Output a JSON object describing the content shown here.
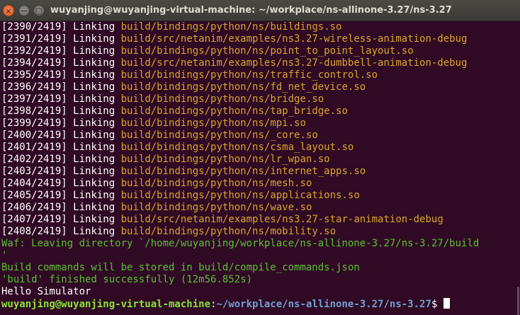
{
  "window": {
    "title": "wuyanjing@wuyanjing-virtual-machine: ~/workplace/ns-allinone-3.27/ns-3.27",
    "close_icon": "×",
    "minimize_icon": "−",
    "maximize_icon": "□"
  },
  "link_lines": [
    {
      "progress": "[2390/2419]",
      "verb": "Linking",
      "path": "build/bindings/python/ns/buildings.so"
    },
    {
      "progress": "[2391/2419]",
      "verb": "Linking",
      "path": "build/src/netanim/examples/ns3.27-wireless-animation-debug"
    },
    {
      "progress": "[2392/2419]",
      "verb": "Linking",
      "path": "build/bindings/python/ns/point_to_point_layout.so"
    },
    {
      "progress": "[2394/2419]",
      "verb": "Linking",
      "path": "build/src/netanim/examples/ns3.27-dumbbell-animation-debug"
    },
    {
      "progress": "[2395/2419]",
      "verb": "Linking",
      "path": "build/bindings/python/ns/traffic_control.so"
    },
    {
      "progress": "[2396/2419]",
      "verb": "Linking",
      "path": "build/bindings/python/ns/fd_net_device.so"
    },
    {
      "progress": "[2397/2419]",
      "verb": "Linking",
      "path": "build/bindings/python/ns/bridge.so"
    },
    {
      "progress": "[2398/2419]",
      "verb": "Linking",
      "path": "build/bindings/python/ns/tap_bridge.so"
    },
    {
      "progress": "[2399/2419]",
      "verb": "Linking",
      "path": "build/bindings/python/ns/mpi.so"
    },
    {
      "progress": "[2400/2419]",
      "verb": "Linking",
      "path": "build/bindings/python/ns/_core.so"
    },
    {
      "progress": "[2401/2419]",
      "verb": "Linking",
      "path": "build/bindings/python/ns/csma_layout.so"
    },
    {
      "progress": "[2402/2419]",
      "verb": "Linking",
      "path": "build/bindings/python/ns/lr_wpan.so"
    },
    {
      "progress": "[2403/2419]",
      "verb": "Linking",
      "path": "build/bindings/python/ns/internet_apps.so"
    },
    {
      "progress": "[2404/2419]",
      "verb": "Linking",
      "path": "build/bindings/python/ns/mesh.so"
    },
    {
      "progress": "[2405/2419]",
      "verb": "Linking",
      "path": "build/bindings/python/ns/applications.so"
    },
    {
      "progress": "[2406/2419]",
      "verb": "Linking",
      "path": "build/bindings/python/ns/wave.so"
    },
    {
      "progress": "[2407/2419]",
      "verb": "Linking",
      "path": "build/src/netanim/examples/ns3.27-star-animation-debug"
    },
    {
      "progress": "[2408/2419]",
      "verb": "Linking",
      "path": "build/bindings/python/ns/mobility.so"
    }
  ],
  "output": {
    "waf_leaving": "Waf: Leaving directory `/home/wuyanjing/workplace/ns-allinone-3.27/ns-3.27/build",
    "waf_leaving_cont": "'",
    "build_commands": "Build commands will be stored in build/compile_commands.json",
    "build_finished": "'build' finished successfully (12m56.852s)",
    "hello": "Hello Simulator"
  },
  "prompt": {
    "user_host": "wuyanjing@wuyanjing-virtual-machine",
    "separator": ":",
    "cwd": "~/workplace/ns-allinone-3.27/ns-3.27",
    "symbol": "$"
  },
  "colors": {
    "background": "#300a24",
    "path": "#d6a52e",
    "waf_green": "#5ac036",
    "prompt_user": "#8ae234",
    "prompt_cwd": "#729fcf"
  }
}
